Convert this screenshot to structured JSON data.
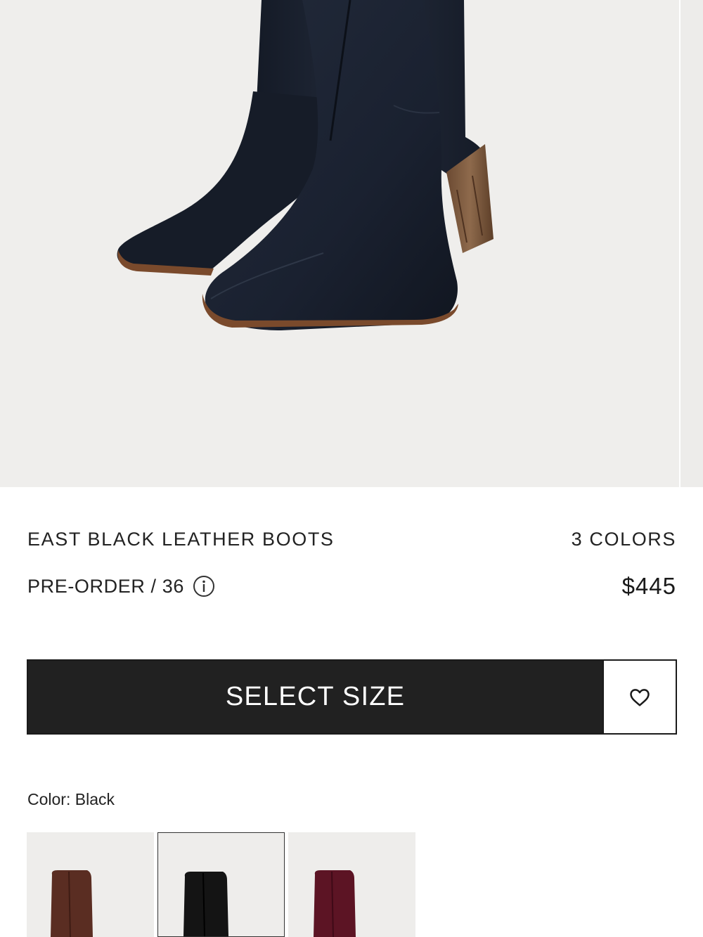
{
  "product": {
    "name": "EAST BLACK LEATHER BOOTS",
    "colors_count_label": "3 COLORS",
    "availability": "PRE-ORDER / 36",
    "price": "$445"
  },
  "actions": {
    "select_size_label": "SELECT SIZE"
  },
  "color_selector": {
    "label": "Color: Black",
    "swatches": [
      {
        "name": "Brown",
        "color": "#5a2d22",
        "selected": false
      },
      {
        "name": "Black",
        "color": "#141414",
        "selected": true
      },
      {
        "name": "Burgundy",
        "color": "#5c1424",
        "selected": false
      }
    ]
  },
  "colors": {
    "button_bg": "#212121",
    "hero_bg": "#efeeec",
    "boot_leather": "#1a2130",
    "heel_wood": "#7a5a40"
  },
  "icons": [
    "info-icon",
    "heart-icon"
  ]
}
